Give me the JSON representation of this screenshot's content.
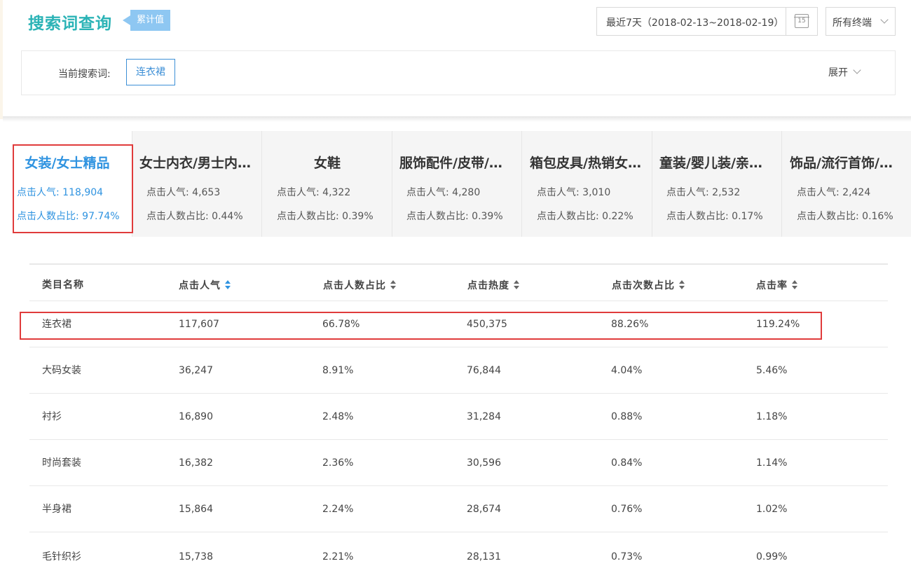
{
  "header": {
    "title": "搜索词查询",
    "tag": "累计值",
    "date_range": "最近7天（2018-02-13~2018-02-19）",
    "calendar_day": "15",
    "terminal": "所有终端"
  },
  "search": {
    "label": "当前搜索词:",
    "keyword": "连衣裙",
    "expand": "展开"
  },
  "categories": [
    {
      "name": "女装/女士精品",
      "stat1": "点击人气: 118,904",
      "stat2": "点击人数占比: 97.74%",
      "active": true
    },
    {
      "name": "女士内衣/男士内衣/家居服",
      "stat1": "点击人气: 4,653",
      "stat2": "点击人数占比: 0.44%"
    },
    {
      "name": "女鞋",
      "stat1": "点击人气: 4,322",
      "stat2": "点击人数占比: 0.39%"
    },
    {
      "name": "服饰配件/皮带/帽子/围巾",
      "stat1": "点击人气: 4,280",
      "stat2": "点击人数占比: 0.39%"
    },
    {
      "name": "箱包皮具/热销女包/男包",
      "stat1": "点击人气: 3,010",
      "stat2": "点击人数占比: 0.22%"
    },
    {
      "name": "童装/婴儿装/亲子装",
      "stat1": "点击人气: 2,532",
      "stat2": "点击人数占比: 0.17%"
    },
    {
      "name": "饰品/流行首饰/时尚饰品新",
      "stat1": "点击人气: 2,424",
      "stat2": "点击人数占比: 0.16%"
    }
  ],
  "table": {
    "headers": [
      "类目名称",
      "点击人气",
      "点击人数占比",
      "点击热度",
      "点击次数占比",
      "点击率"
    ],
    "rows": [
      [
        "连衣裙",
        "117,607",
        "66.78%",
        "450,375",
        "88.26%",
        "119.24%"
      ],
      [
        "大码女装",
        "36,247",
        "8.91%",
        "76,844",
        "4.04%",
        "5.46%"
      ],
      [
        "衬衫",
        "16,890",
        "2.48%",
        "31,284",
        "0.88%",
        "1.18%"
      ],
      [
        "时尚套装",
        "16,382",
        "2.36%",
        "30,596",
        "0.84%",
        "1.14%"
      ],
      [
        "半身裙",
        "15,864",
        "2.24%",
        "28,674",
        "0.76%",
        "1.02%"
      ],
      [
        "毛针织衫",
        "15,738",
        "2.21%",
        "28,131",
        "0.73%",
        "0.99%"
      ]
    ]
  },
  "colors": {
    "title": "#2bb3b6",
    "accent_blue": "#2f93e0",
    "highlight_red": "#e03b3b",
    "tag_bg": "#8ec7f2"
  }
}
